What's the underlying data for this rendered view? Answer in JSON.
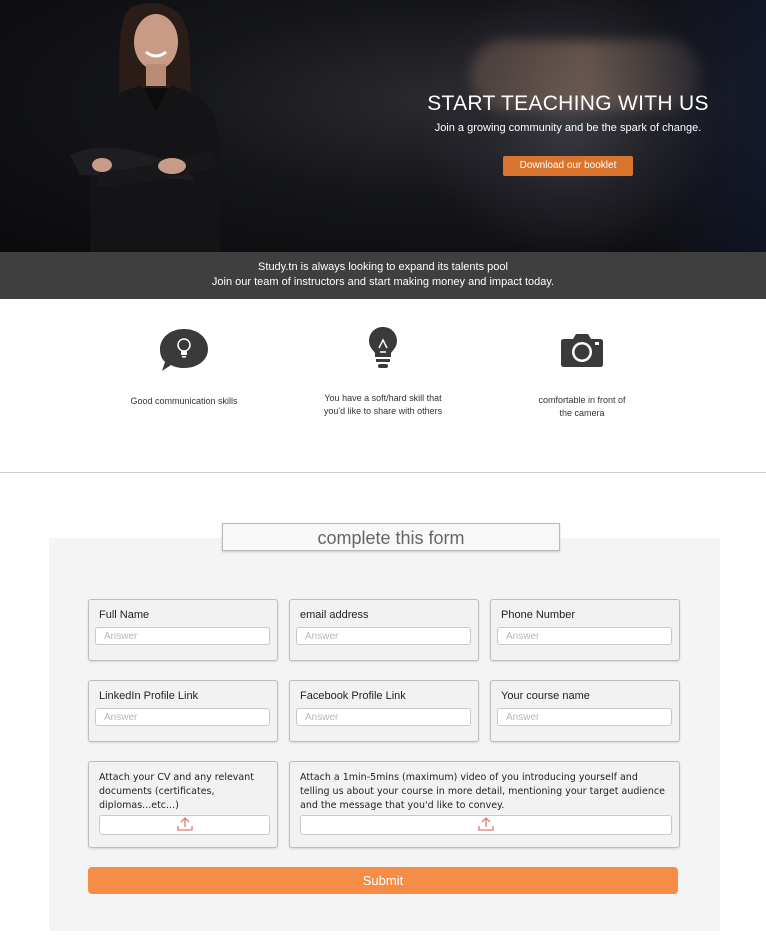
{
  "hero": {
    "title": "START TEACHING WITH US",
    "subtitle": "Join a growing community and be the spark of change.",
    "booklet_button": "Download our booklet"
  },
  "banner": {
    "line1": "Study.tn is always looking to expand its talents pool",
    "line2": "Join our team of instructors and start making money and impact today."
  },
  "features": [
    {
      "icon": "chat-bulb-icon",
      "text": "Good communication skills"
    },
    {
      "icon": "lightbulb-icon",
      "line1": "You have a soft/hard skill that",
      "line2": "you'd like to share with others"
    },
    {
      "icon": "camera-icon",
      "line1": "comfortable in front of",
      "line2": "the camera"
    }
  ],
  "form": {
    "title": "complete this form",
    "fields": [
      {
        "label": "Full Name",
        "placeholder": "Answer"
      },
      {
        "label": "email address",
        "placeholder": "Answer"
      },
      {
        "label": "Phone Number",
        "placeholder": "Answer"
      },
      {
        "label": "LinkedIn Profile Link",
        "placeholder": "Answer"
      },
      {
        "label": "Facebook Profile Link",
        "placeholder": "Answer"
      },
      {
        "label": "Your course name",
        "placeholder": "Answer"
      }
    ],
    "cv_label": "Attach your CV and any relevant documents (certificates, diplomas...etc...)",
    "video_label": "Attach a 1min-5mins (maximum) video of you introducing yourself and telling us about your course in more detail, mentioning your target audience and the message that you'd like to convey.",
    "submit": "Submit"
  },
  "colors": {
    "accent": "#f68d47",
    "booklet_button": "#d9742f",
    "banner": "#3f3f3f",
    "upload_icon": "#e07a6a"
  }
}
